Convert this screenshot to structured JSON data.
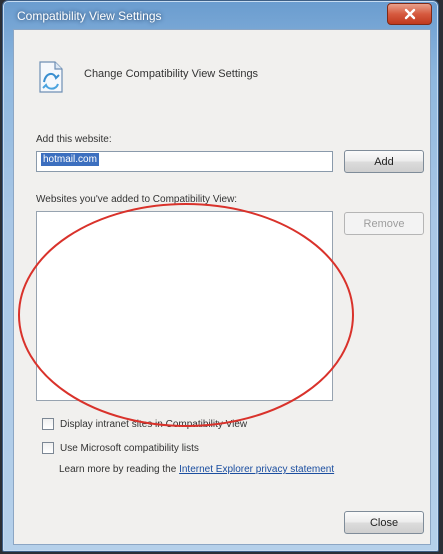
{
  "window": {
    "title": "Compatibility View Settings",
    "close_icon": "close-icon"
  },
  "header": {
    "icon": "compatibility-view-icon",
    "title": "Change Compatibility View Settings"
  },
  "add_section": {
    "label": "Add this website:",
    "input_value": "hotmail.com",
    "add_button": "Add"
  },
  "list_section": {
    "label": "Websites you've added to Compatibility View:",
    "items": [],
    "remove_button": "Remove"
  },
  "options": {
    "intranet_label": "Display intranet sites in Compatibility View",
    "microsoft_lists_label": "Use Microsoft compatibility lists"
  },
  "learn_more": {
    "prefix": "Learn more by reading the",
    "link_text": "Internet Explorer privacy statement"
  },
  "footer": {
    "close_button": "Close"
  },
  "annotation": {
    "shape": "ellipse",
    "color": "#d9322b"
  }
}
